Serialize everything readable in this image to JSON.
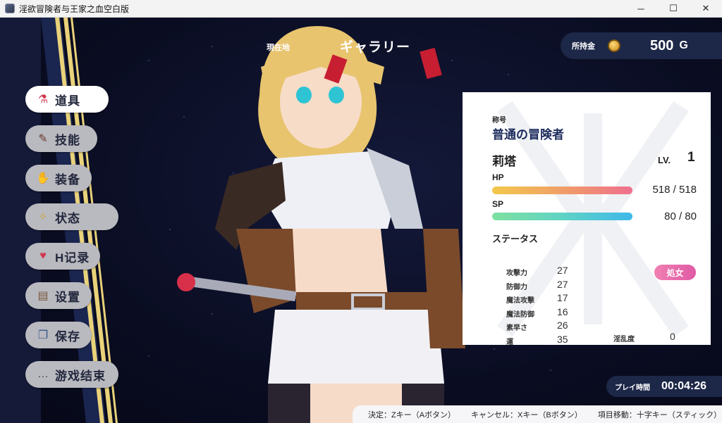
{
  "window": {
    "title": "淫欲冒険者与王家之血空白版",
    "minimize_glyph": "─",
    "maximize_glyph": "☐",
    "close_glyph": "✕"
  },
  "menu": {
    "items": [
      {
        "label": "道具",
        "icon": "potion-icon",
        "glyph": "⚗",
        "active": true
      },
      {
        "label": "技能",
        "icon": "wand-icon",
        "glyph": "✎",
        "active": false
      },
      {
        "label": "装备",
        "icon": "glove-icon",
        "glyph": "✋",
        "active": false
      },
      {
        "label": "状态",
        "icon": "sparkle-icon",
        "glyph": "✧",
        "active": false
      },
      {
        "label": "H记录",
        "icon": "heart-icon",
        "glyph": "♥",
        "active": false
      },
      {
        "label": "设置",
        "icon": "scroll-icon",
        "glyph": "▤",
        "active": false
      },
      {
        "label": "保存",
        "icon": "book-icon",
        "glyph": "❐",
        "active": false
      },
      {
        "label": "游戏结束",
        "icon": "chat-icon",
        "glyph": "…",
        "active": false
      }
    ]
  },
  "location": {
    "label": "現在地",
    "value": "ギャラリー"
  },
  "gold": {
    "label": "所持金",
    "value": "500",
    "unit": "G"
  },
  "status": {
    "title_label": "称号",
    "title": "普通の冒険者",
    "name": "莉塔",
    "level_label": "LV.",
    "level": "1",
    "hp_label": "HP",
    "hp_value": "518 / 518",
    "hp_fraction": 1.0,
    "sp_label": "SP",
    "sp_value": "80 / 80",
    "sp_fraction": 1.0,
    "stats_heading": "ステータス",
    "stats": [
      {
        "label": "攻撃力",
        "value": "27"
      },
      {
        "label": "防御力",
        "value": "27"
      },
      {
        "label": "魔法攻撃",
        "value": "17"
      },
      {
        "label": "魔法防御",
        "value": "16"
      },
      {
        "label": "素早さ",
        "value": "26"
      },
      {
        "label": "運",
        "value": "35"
      }
    ],
    "badge": "処女",
    "lewdness_label": "淫乱度",
    "lewdness_value": "0"
  },
  "playtime": {
    "label": "プレイ時間",
    "value": "00:04:26"
  },
  "help": {
    "confirm": "決定：Zキー（Aボタン）",
    "cancel": "キャンセル：Xキー（Bボタン）",
    "move": "項目移動：十字キー（スティック）"
  },
  "colors": {
    "background": "#0b0f22",
    "panel": "#ffffff",
    "accent_navy": "#1d2748",
    "hp_bar": "#ef6f8f",
    "sp_bar": "#3fb8ea",
    "badge": "#e05aa4"
  }
}
